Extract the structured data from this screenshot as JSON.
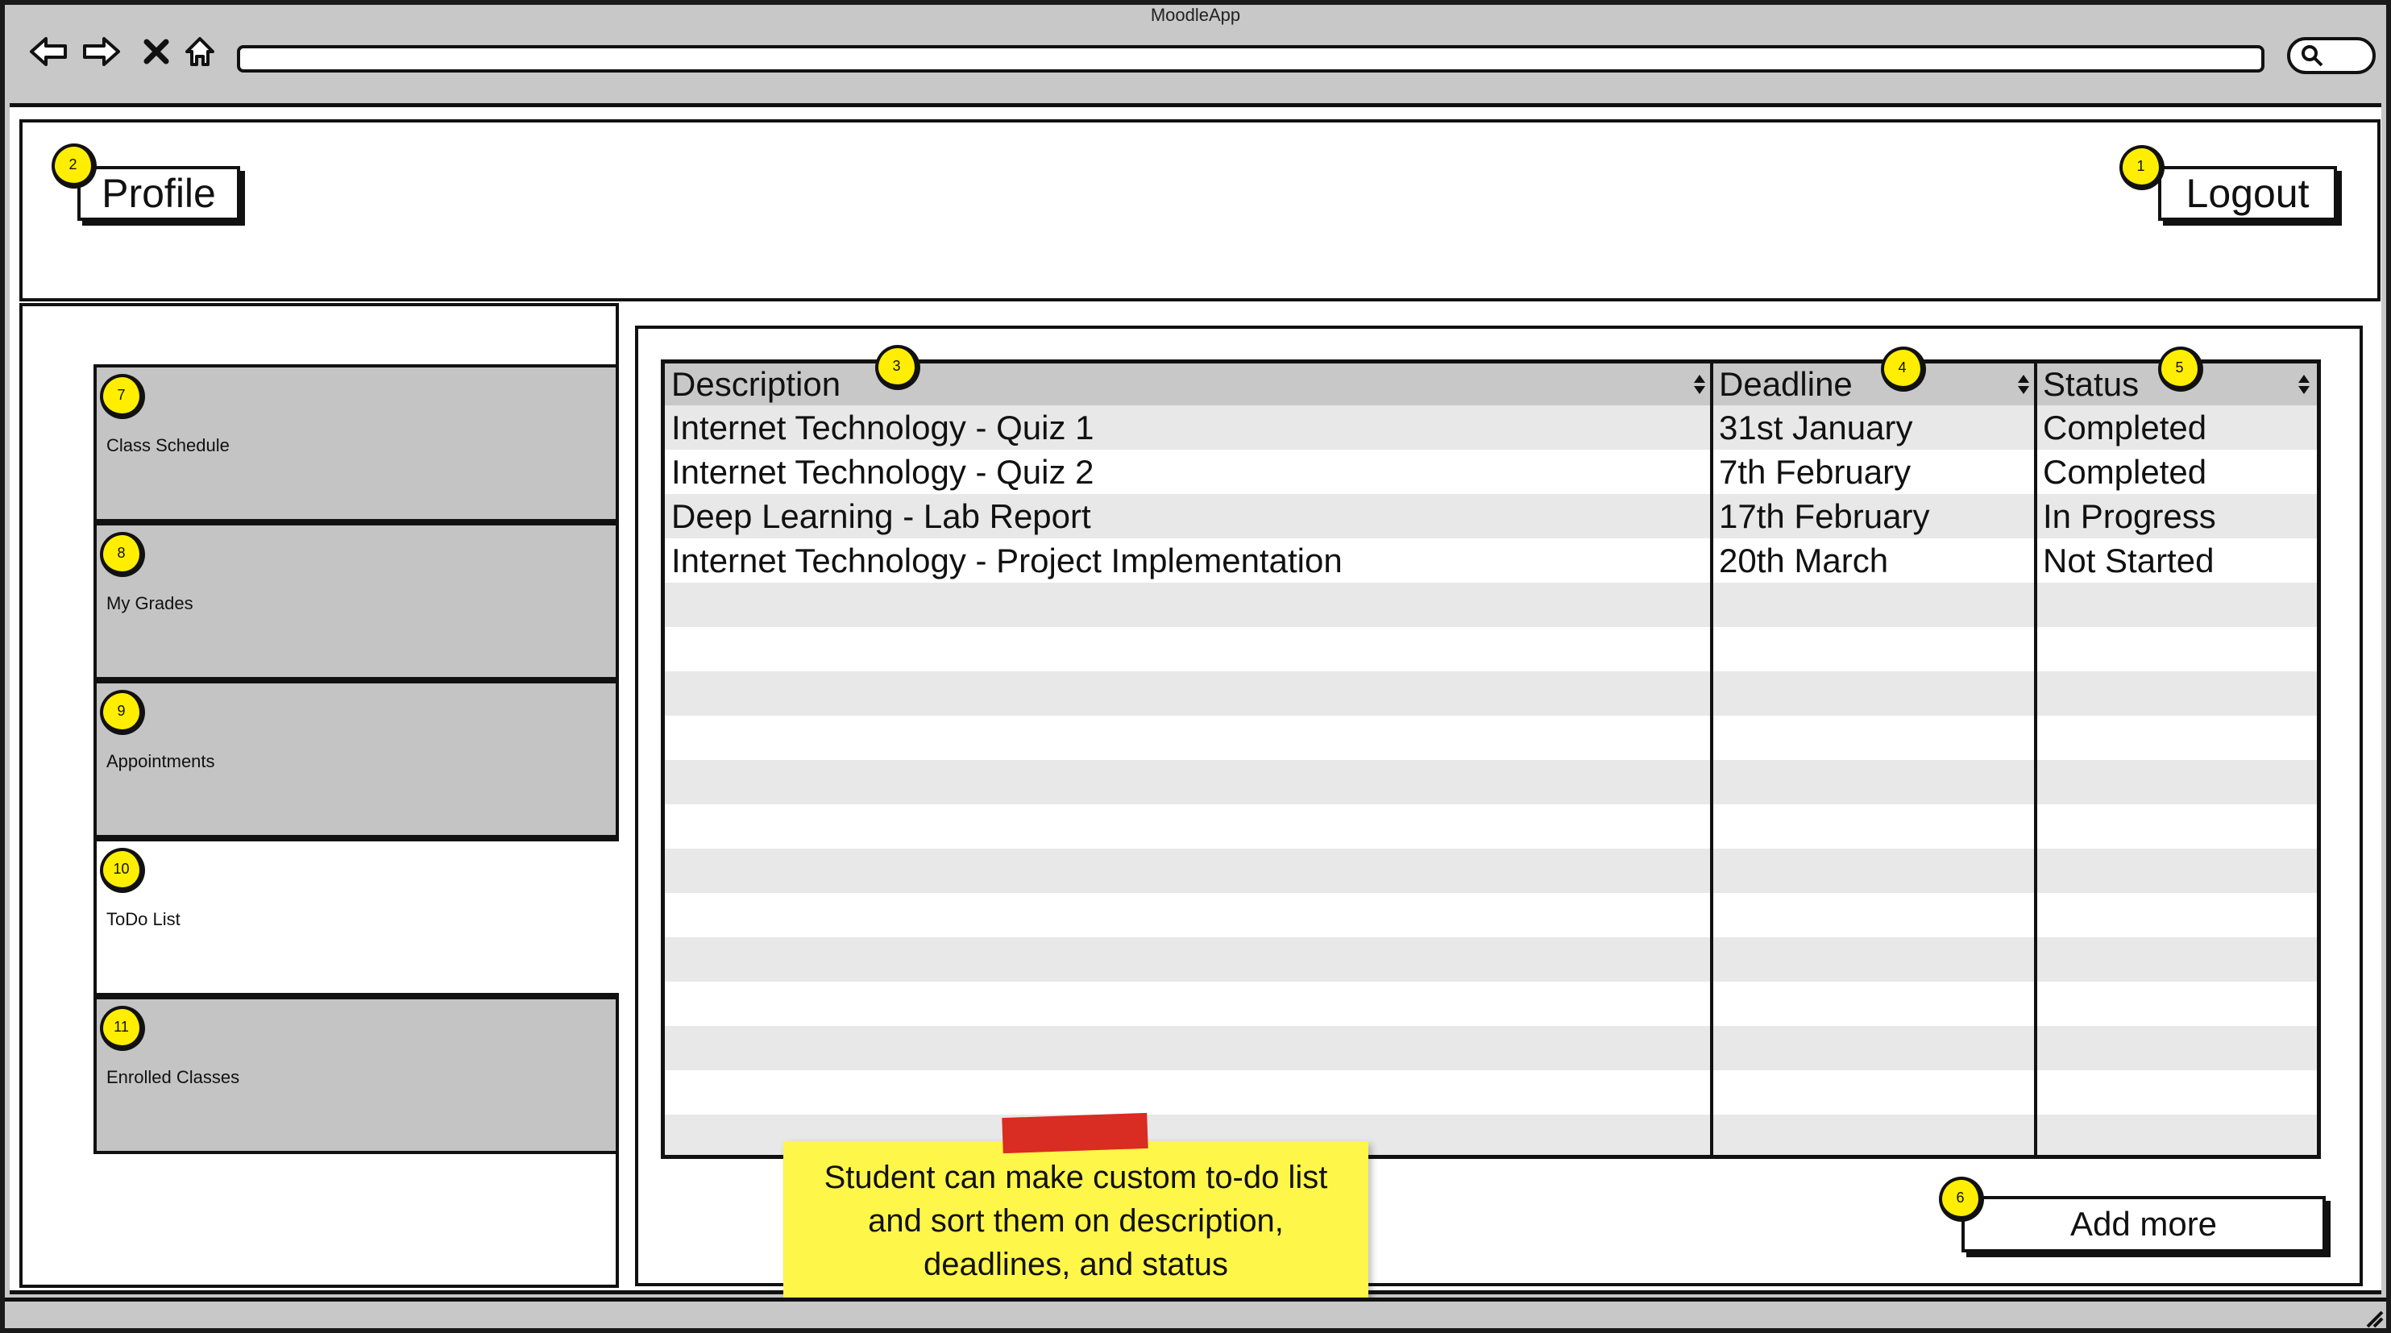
{
  "window": {
    "title": "MoodleApp"
  },
  "toolbar": {
    "back_icon": "arrow-left-outline-icon",
    "forward_icon": "arrow-right-outline-icon",
    "stop_icon": "x-icon",
    "home_icon": "house-icon",
    "search_icon": "magnifier-icon"
  },
  "header": {
    "profile_label": "Profile",
    "logout_label": "Logout"
  },
  "badges": {
    "logout": "1",
    "profile": "2",
    "description": "3",
    "deadline": "4",
    "status": "5",
    "add_more": "6",
    "class_schedule": "7",
    "my_grades": "8",
    "appointments": "9",
    "todo_list": "10",
    "enrolled_classes": "11"
  },
  "sidebar": {
    "items": [
      {
        "label": "Class Schedule"
      },
      {
        "label": "My Grades"
      },
      {
        "label": "Appointments"
      },
      {
        "label": "ToDo List",
        "active": true
      },
      {
        "label": "Enrolled Classes"
      }
    ]
  },
  "table": {
    "columns": [
      "Description",
      "Deadline",
      "Status"
    ],
    "rows": [
      [
        "Internet Technology - Quiz 1",
        "31st January",
        "Completed"
      ],
      [
        "Internet Technology - Quiz 2",
        "7th February",
        "Completed"
      ],
      [
        "Deep Learning - Lab Report",
        "17th February",
        "In Progress"
      ],
      [
        "Internet Technology - Project Implementation",
        "20th March",
        "Not Started"
      ]
    ]
  },
  "actions": {
    "add_more_label": "Add more"
  },
  "note": {
    "text": "Student can make custom to-do list and sort them on description, deadlines, and status"
  },
  "colors": {
    "badge": "#ffee00",
    "sticky_note": "#fff64a",
    "sticky_tape": "#d92c22",
    "chrome": "#c8c8c8",
    "sidebar_item": "#c4c4c4",
    "row_stripe": "#e8e8e8"
  }
}
